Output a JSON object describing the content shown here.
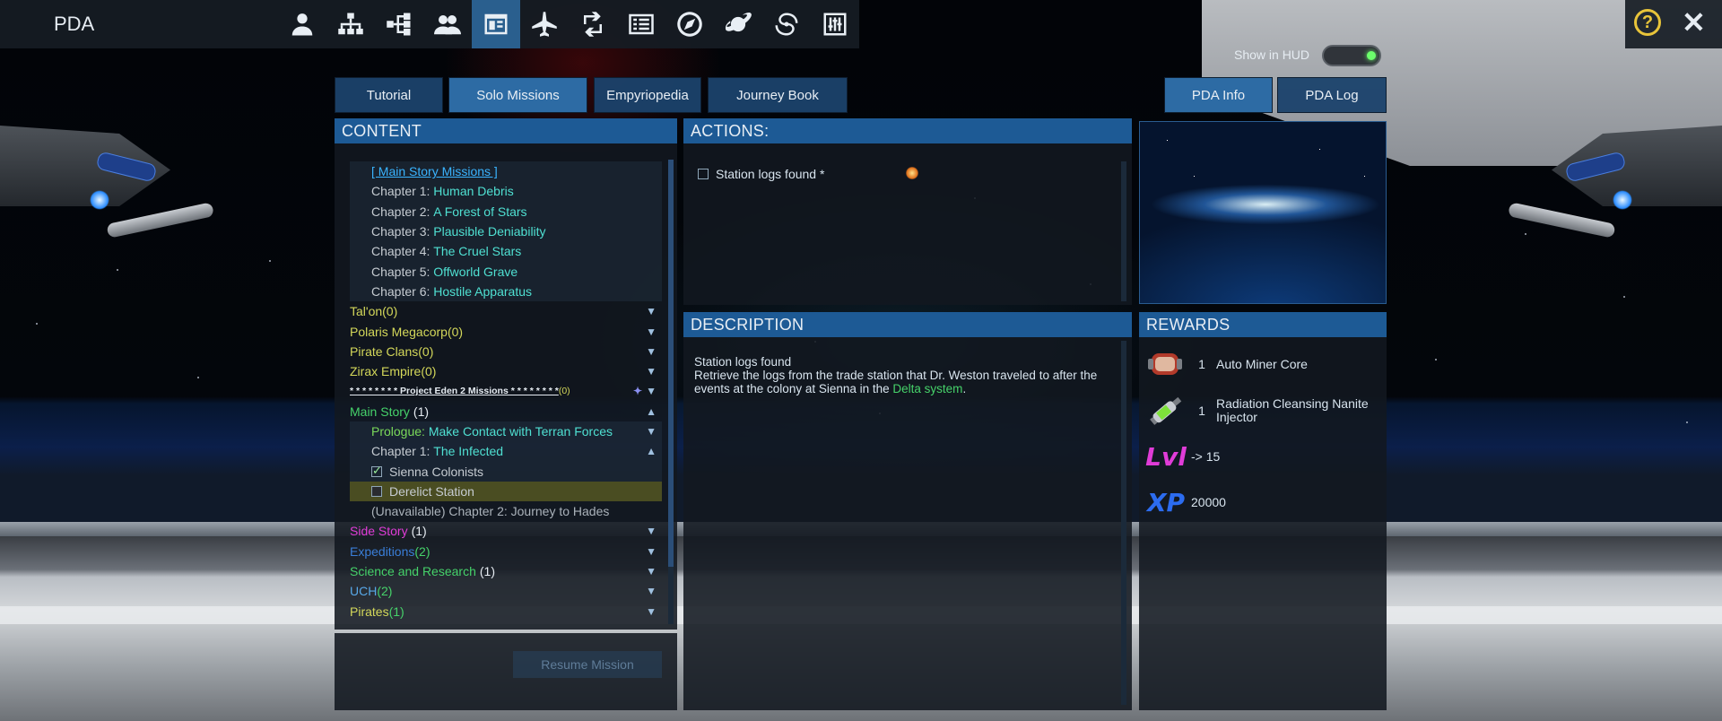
{
  "app": {
    "title": "PDA"
  },
  "nav_icons": [
    "person-icon",
    "org-chart-icon",
    "tree-icon",
    "group-icon",
    "pda-book-icon",
    "ship-icon",
    "exchange-icon",
    "list-icon",
    "compass-icon",
    "planet-icon",
    "galaxy-icon",
    "sliders-icon"
  ],
  "nav_active_index": 4,
  "hud": {
    "label": "Show in HUD"
  },
  "tabs": {
    "left": [
      "Tutorial",
      "Solo Missions",
      "Empyriopedia",
      "Journey Book"
    ],
    "right": [
      "PDA Info",
      "PDA Log"
    ],
    "active": "Solo Missions"
  },
  "content": {
    "header": "CONTENT",
    "main_story_link": "[ Main Story Missions ]",
    "chapters": [
      {
        "prefix": "Chapter 1:",
        "title": "Human Debris"
      },
      {
        "prefix": "Chapter 2:",
        "title": "A Forest of Stars"
      },
      {
        "prefix": "Chapter 3:",
        "title": "Plausible Deniability"
      },
      {
        "prefix": "Chapter 4:",
        "title": "The Cruel Stars"
      },
      {
        "prefix": "Chapter 5:",
        "title": "Offworld Grave"
      },
      {
        "prefix": "Chapter 6:",
        "title": "Hostile Apparatus"
      }
    ],
    "factions": [
      "Tal'on(0)",
      "Polaris Megacorp(0)",
      "Pirate Clans(0)",
      "Zirax Empire(0)"
    ],
    "project_eden": "* * * * * * * * Project Eden 2 Missions * * * * * * * *",
    "project_eden_count": "(0)",
    "main_story": {
      "label": "Main Story",
      "count": "(1)"
    },
    "prologue": {
      "prefix": "Prologue:",
      "title": "Make Contact with Terran Forces"
    },
    "chapter1": {
      "prefix": "Chapter 1:",
      "title": "The Infected"
    },
    "tasks": [
      {
        "label": "Sienna Colonists",
        "checked": true
      },
      {
        "label": "Derelict Station",
        "checked": false
      }
    ],
    "unavailable": "(Unavailable) Chapter 2: Journey to Hades",
    "side_story": {
      "label": "Side Story",
      "count": "(1)"
    },
    "expeditions": {
      "label": "Expeditions",
      "count": "(2)"
    },
    "science": {
      "label": "Science and Research",
      "count": "(1)"
    },
    "uch": {
      "label": "UCH",
      "count": "(2)"
    },
    "pirates": {
      "label": "Pirates",
      "count": "(1)"
    },
    "resume_button": "Resume Mission"
  },
  "actions": {
    "header": "ACTIONS:",
    "items": [
      {
        "label": "Station logs found *",
        "checked": false
      }
    ]
  },
  "description": {
    "header": "DESCRIPTION",
    "title": "Station logs found",
    "body_before": "Retrieve the logs from the trade station that Dr. Weston traveled to after the events at the colony at Sienna in the ",
    "highlight": "Delta system",
    "body_after": "."
  },
  "rewards": {
    "header": "REWARDS",
    "items": [
      {
        "icon": "auto-miner-core-icon",
        "qty": "1",
        "name": "Auto Miner Core"
      },
      {
        "icon": "nanite-injector-icon",
        "qty": "1",
        "name": "Radiation Cleansing Nanite Injector"
      }
    ],
    "level": {
      "icon_text": "Lvl",
      "value": "-> 15"
    },
    "xp": {
      "icon_text": "XP",
      "value": "20000"
    }
  },
  "colors": {
    "tab_bg": "#1b426c",
    "tab_active": "#2d6ba4",
    "header_bg": "#1d5a95",
    "faction_yellow": "#d4d85a",
    "chapter_cyan": "#4fe0d2",
    "green": "#46d26a",
    "magenta": "#e03cd8",
    "help_yellow": "#e8c43a"
  }
}
